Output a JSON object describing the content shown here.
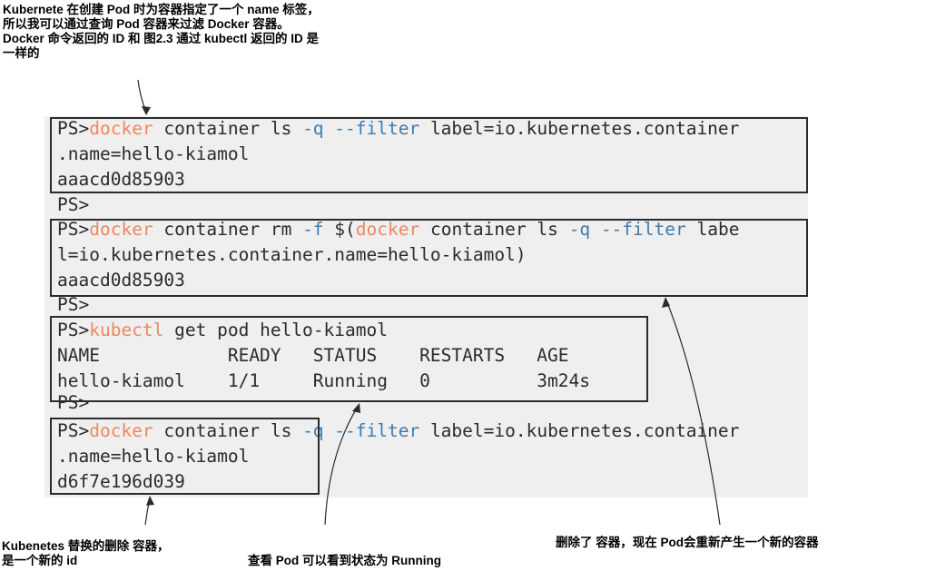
{
  "annotations": {
    "top": [
      "Kubernete 在创建 Pod 时为容器指定了一个 name 标签，",
      "所以我可以通过查询 Pod 容器来过滤 Docker 容器。",
      "Docker 命令返回的 ID 和 图2.3 通过 kubectl 返回的 ID 是",
      "一样的"
    ],
    "bottom_left": [
      "Kubenetes 替换的删除 容器，",
      "是一个新的 id"
    ],
    "bottom_center": "查看 Pod 可以看到状态为 Running",
    "bottom_right": "删除了 容器，现在 Pod会重新产生一个新的容器"
  },
  "terminal": {
    "prompt": "PS>",
    "block1": {
      "cmd": "docker",
      "rest1": " container ls ",
      "flag": "-q --filter",
      "rest2": " label=io.kubernetes.container",
      "line2": ".name=hello-kiamol",
      "line3": "aaacd0d85903"
    },
    "block2": {
      "cmd": "docker",
      "rest1": " container rm ",
      "flag1": "-f",
      "rest2": " $(",
      "cmd2": "docker",
      "rest3": " container ls ",
      "flag2": "-q --filter",
      "rest4": " labe",
      "line2": "l=io.kubernetes.container.name=hello-kiamol)",
      "line3": "aaacd0d85903"
    },
    "block3": {
      "cmd": "kubectl",
      "rest": " get pod hello-kiamol",
      "header": "NAME            READY   STATUS    RESTARTS   AGE",
      "row": "hello-kiamol    1/1     Running   0          3m24s"
    },
    "block4": {
      "cmd": "docker",
      "rest1": " container ls ",
      "flag": "-q --filter",
      "rest2": " label=io.kubernetes.container",
      "line2": ".name=hello-kiamol",
      "line3": "d6f7e196d039"
    }
  }
}
